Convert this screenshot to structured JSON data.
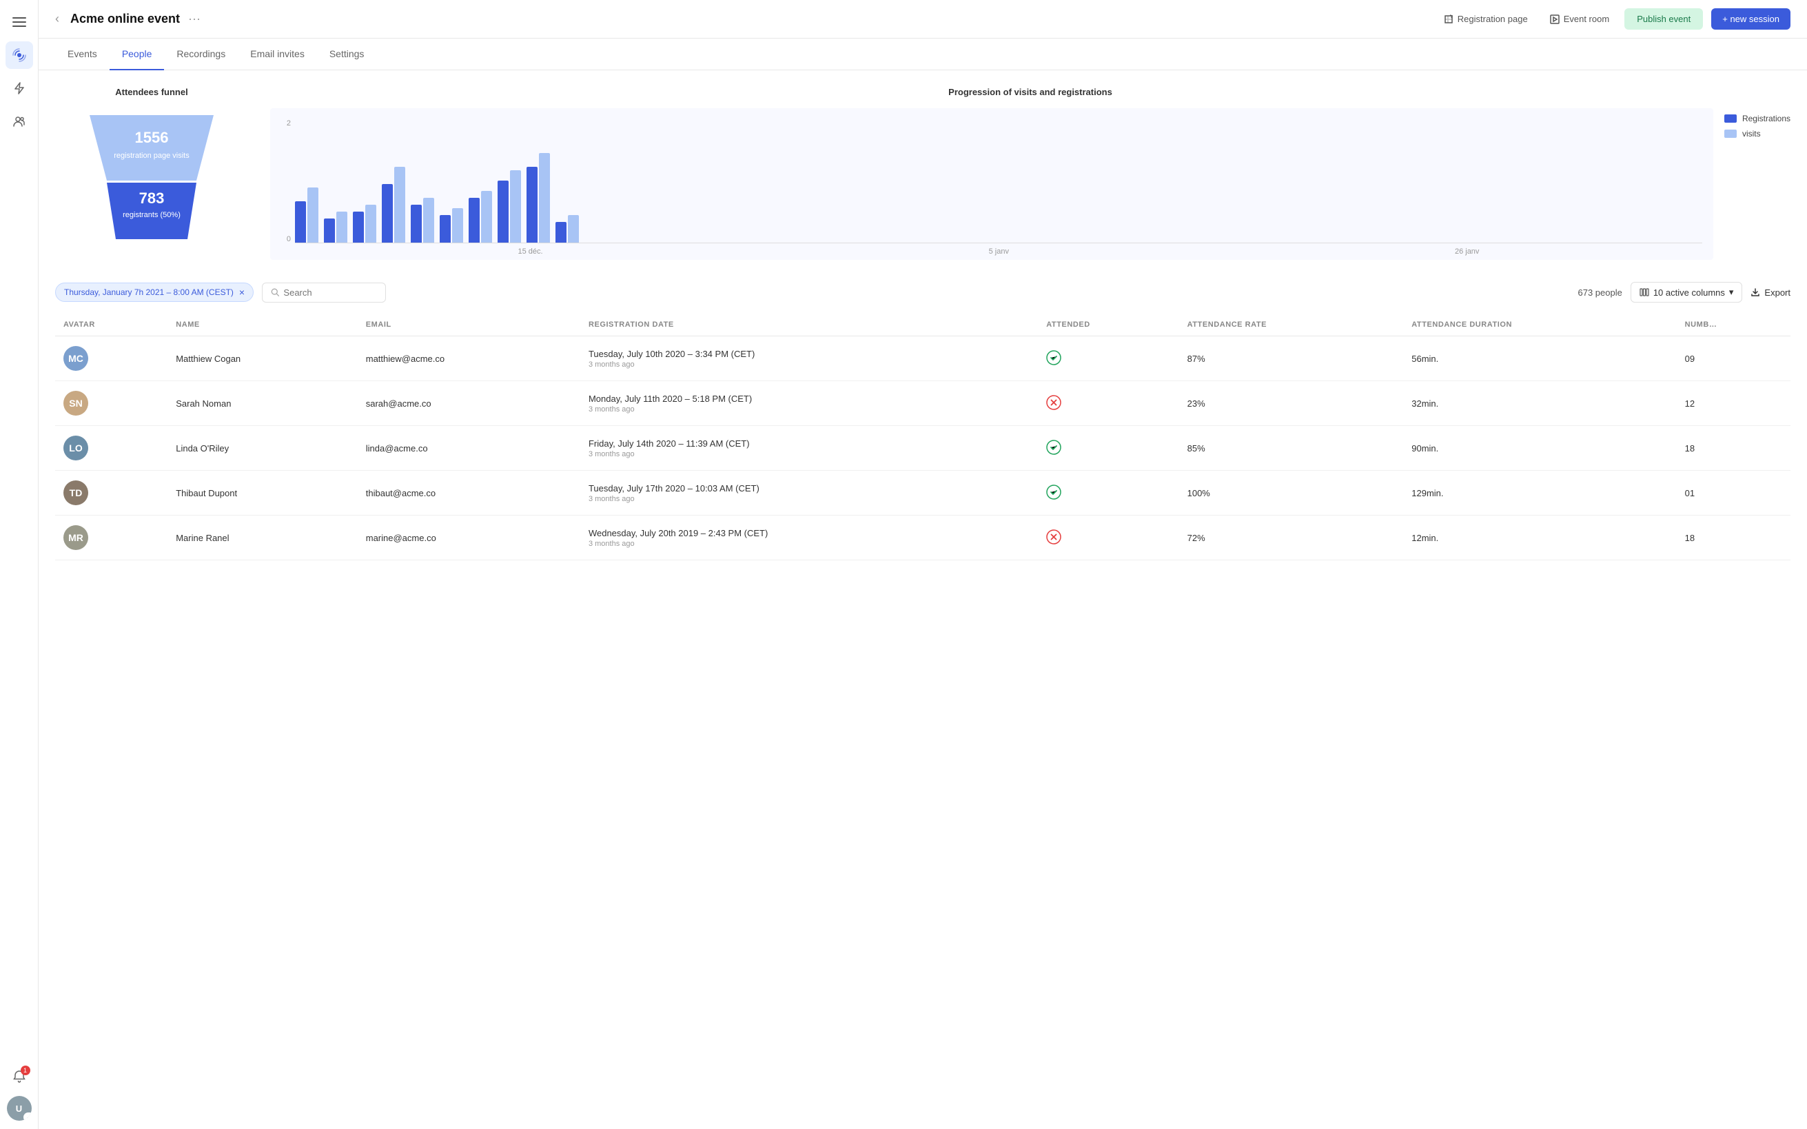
{
  "app": {
    "title": "Acme online event",
    "back_icon": "‹",
    "more_icon": "···"
  },
  "header": {
    "registration_page": "Registration page",
    "event_room": "Event room",
    "publish_event": "Publish event",
    "new_session": "+ new session"
  },
  "tabs": [
    {
      "id": "events",
      "label": "Events",
      "active": false
    },
    {
      "id": "people",
      "label": "People",
      "active": true
    },
    {
      "id": "recordings",
      "label": "Recordings",
      "active": false
    },
    {
      "id": "email-invites",
      "label": "Email invites",
      "active": false
    },
    {
      "id": "settings",
      "label": "Settings",
      "active": false
    }
  ],
  "funnel": {
    "title": "Attendees funnel",
    "top_count": "1556",
    "top_label": "registration page visits",
    "bottom_count": "783",
    "bottom_label": "registrants (50%)"
  },
  "chart": {
    "title": "Progression of visits and registrations",
    "y_max": "2",
    "y_min": "0",
    "legend": [
      {
        "label": "Registrations",
        "color": "#3b5bdb"
      },
      {
        "label": "visits",
        "color": "#a8c4f5"
      }
    ],
    "x_labels": [
      "15 déc.",
      "5 janv",
      "26 janv"
    ],
    "bars": [
      {
        "reg": 60,
        "vis": 80
      },
      {
        "reg": 35,
        "vis": 45
      },
      {
        "reg": 45,
        "vis": 55
      },
      {
        "reg": 85,
        "vis": 110
      },
      {
        "reg": 55,
        "vis": 65
      },
      {
        "reg": 40,
        "vis": 50
      },
      {
        "reg": 65,
        "vis": 75
      },
      {
        "reg": 90,
        "vis": 105
      },
      {
        "reg": 110,
        "vis": 130
      },
      {
        "reg": 30,
        "vis": 40
      }
    ]
  },
  "toolbar": {
    "filter_label": "Thursday, January 7h 2021 – 8:00 AM (CEST)",
    "search_placeholder": "Search",
    "people_count": "673 people",
    "columns_label": "10 active columns",
    "export_label": "Export"
  },
  "table": {
    "headers": [
      {
        "id": "avatar",
        "label": "AVATAR"
      },
      {
        "id": "name",
        "label": "NAME"
      },
      {
        "id": "email",
        "label": "EMAIL"
      },
      {
        "id": "reg_date",
        "label": "REGISTRATION DATE"
      },
      {
        "id": "attended",
        "label": "ATTENDED"
      },
      {
        "id": "att_rate",
        "label": "ATTENDANCE RATE"
      },
      {
        "id": "att_dur",
        "label": "ATTENDANCE DURATION"
      },
      {
        "id": "num",
        "label": "NUMB…"
      }
    ],
    "rows": [
      {
        "id": 1,
        "name": "Matthiew Cogan",
        "email": "matthiew@acme.co",
        "reg_date": "Tuesday, July 10th 2020 – 3:34 PM (CET)",
        "reg_ago": "3 months ago",
        "attended": true,
        "att_rate": "87%",
        "att_dur": "56min.",
        "num": "09",
        "av_class": "av-0",
        "av_text": "MC"
      },
      {
        "id": 2,
        "name": "Sarah Noman",
        "email": "sarah@acme.co",
        "reg_date": "Monday, July 11th 2020 – 5:18 PM (CET)",
        "reg_ago": "3 months ago",
        "attended": false,
        "att_rate": "23%",
        "att_dur": "32min.",
        "num": "12",
        "av_class": "av-1",
        "av_text": "SN"
      },
      {
        "id": 3,
        "name": "Linda O'Riley",
        "email": "linda@acme.co",
        "reg_date": "Friday, July 14th 2020 – 11:39 AM (CET)",
        "reg_ago": "3 months ago",
        "attended": true,
        "att_rate": "85%",
        "att_dur": "90min.",
        "num": "18",
        "av_class": "av-2",
        "av_text": "LO"
      },
      {
        "id": 4,
        "name": "Thibaut Dupont",
        "email": "thibaut@acme.co",
        "reg_date": "Tuesday, July 17th 2020 – 10:03 AM (CET)",
        "reg_ago": "3 months ago",
        "attended": true,
        "att_rate": "100%",
        "att_dur": "129min.",
        "num": "01",
        "av_class": "av-3",
        "av_text": "TD"
      },
      {
        "id": 5,
        "name": "Marine Ranel",
        "email": "marine@acme.co",
        "reg_date": "Wednesday, July 20th 2019 – 2:43 PM (CET)",
        "reg_ago": "3 months ago",
        "attended": false,
        "att_rate": "72%",
        "att_dur": "12min.",
        "num": "18",
        "av_class": "av-4",
        "av_text": "MR"
      }
    ]
  },
  "sidebar": {
    "icons": [
      {
        "name": "menu-icon",
        "symbol": "☰",
        "active": false
      },
      {
        "name": "broadcast-icon",
        "symbol": "📡",
        "active": true
      },
      {
        "name": "lightning-icon",
        "symbol": "⚡",
        "active": false
      },
      {
        "name": "people-icon",
        "symbol": "👥",
        "active": false
      }
    ],
    "notification_count": "1"
  }
}
